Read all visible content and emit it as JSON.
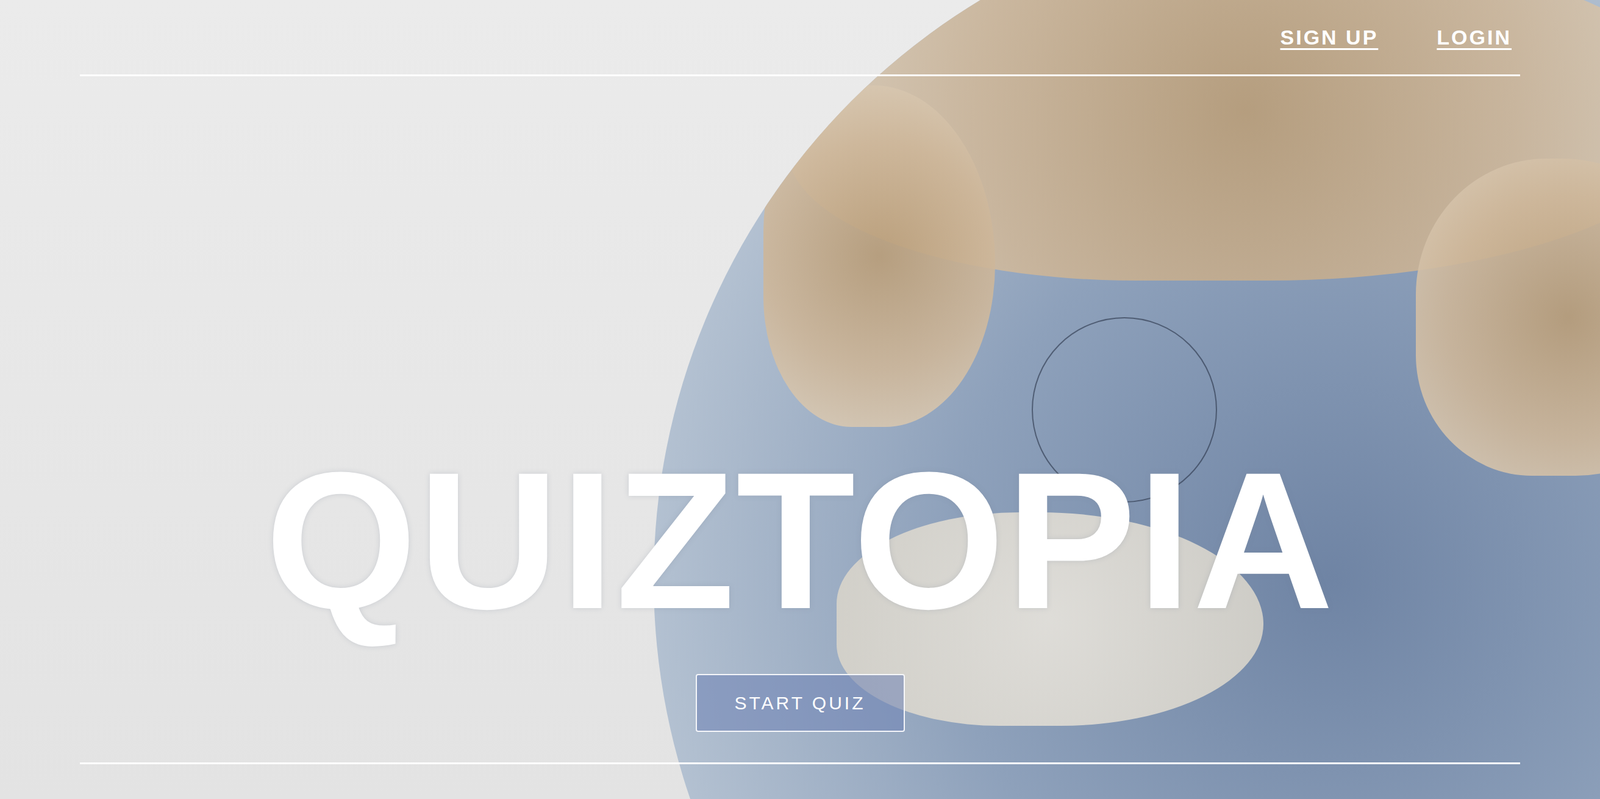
{
  "nav": {
    "links": [
      {
        "label": "SIGN UP"
      },
      {
        "label": "LOGIN"
      }
    ]
  },
  "hero": {
    "title": "QUIZTOPIA",
    "button": "START QUIZ"
  }
}
